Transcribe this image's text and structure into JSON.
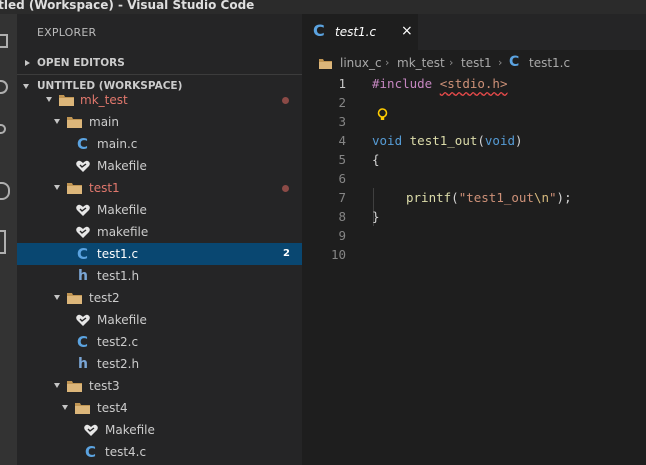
{
  "window": {
    "title": "itled (Workspace) - Visual Studio Code"
  },
  "sidebar": {
    "title": "EXPLORER",
    "sections": {
      "open_editors": "OPEN EDITORS",
      "workspace": "UNTITLED (WORKSPACE)"
    },
    "tree": [
      {
        "label": "mk_test",
        "type": "folder",
        "modified": true
      },
      {
        "label": "main",
        "type": "folder"
      },
      {
        "label": "main.c",
        "type": "c"
      },
      {
        "label": "Makefile",
        "type": "makefile"
      },
      {
        "label": "test1",
        "type": "folder",
        "modified": true
      },
      {
        "label": "Makefile",
        "type": "makefile"
      },
      {
        "label": "makefile",
        "type": "makefile"
      },
      {
        "label": "test1.c",
        "type": "c",
        "selected": true,
        "badge": "2"
      },
      {
        "label": "test1.h",
        "type": "h"
      },
      {
        "label": "test2",
        "type": "folder"
      },
      {
        "label": "Makefile",
        "type": "makefile"
      },
      {
        "label": "test2.c",
        "type": "c"
      },
      {
        "label": "test2.h",
        "type": "h"
      },
      {
        "label": "test3",
        "type": "folder"
      },
      {
        "label": "test4",
        "type": "folder"
      },
      {
        "label": "Makefile",
        "type": "makefile"
      },
      {
        "label": "test4.c",
        "type": "c"
      }
    ]
  },
  "editor": {
    "tab": {
      "label": "test1.c",
      "close": "×"
    },
    "breadcrumbs": [
      "linux_c",
      "mk_test",
      "test1",
      "test1.c"
    ],
    "breadcrumb_separator": "›",
    "line_numbers": [
      "1",
      "2",
      "3",
      "4",
      "5",
      "6",
      "7",
      "8",
      "9",
      "10"
    ],
    "code": {
      "l1_directive": "#include",
      "l1_header": "<stdio.h>",
      "l4_type": "void",
      "l4_name": "test1_out",
      "l4_param": "void",
      "l5": "{",
      "l7_fn": "printf",
      "l7_str_a": "\"test1_out",
      "l7_esc": "\\n",
      "l7_str_b": "\"",
      "l8": "}"
    }
  },
  "colors": {
    "accent_selection": "#094771",
    "c_icon": "#5ba3e0",
    "modified": "#e2786d",
    "folder": "#c09553",
    "keyword": "#569cd6",
    "string": "#ce9178",
    "function": "#dcdcaa",
    "preprocessor": "#c586c0"
  },
  "icons": {
    "folder": "folder-icon",
    "c_file": "c-file-icon",
    "h_file": "h-file-icon",
    "makefile": "makefile-icon",
    "lightbulb": "lightbulb-icon"
  }
}
